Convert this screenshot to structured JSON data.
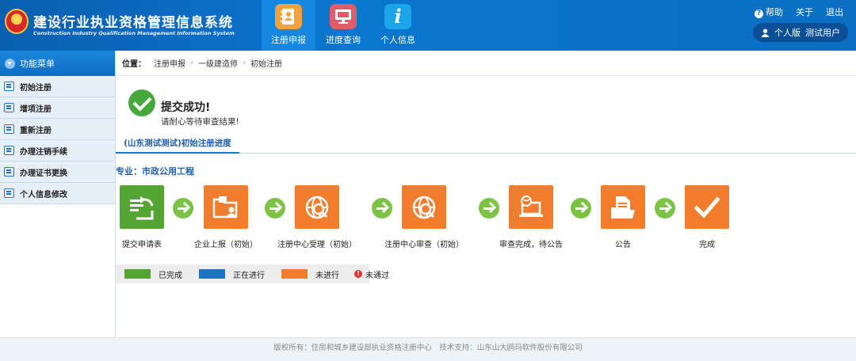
{
  "header": {
    "title": "建设行业执业资格管理信息系统",
    "subtitle": "Construction Industry Qualification Management Information System",
    "nav": [
      {
        "label": "注册申报",
        "icon": "contacts-book-icon",
        "color": "#f3a13a",
        "active": true
      },
      {
        "label": "进度查询",
        "icon": "monitor-icon",
        "color": "#e35a6a",
        "active": false
      },
      {
        "label": "个人信息",
        "icon": "info-icon",
        "color": "#1aa4ea",
        "active": false
      }
    ],
    "links": {
      "help": "帮助",
      "about": "关于",
      "logout": "退出"
    },
    "user": {
      "edition": "个人版",
      "name": "测试用户"
    }
  },
  "sidebar": {
    "title": "功能菜单",
    "items": [
      {
        "label": "初始注册"
      },
      {
        "label": "增项注册"
      },
      {
        "label": "重新注册"
      },
      {
        "label": "办理注销手续"
      },
      {
        "label": "办理证书更换"
      },
      {
        "label": "个人信息修改"
      }
    ]
  },
  "breadcrumb": {
    "label": "位置：",
    "items": [
      "注册申报",
      "一级建造师",
      "初始注册"
    ]
  },
  "result": {
    "title": "提交成功!",
    "message": "请耐心等待审查结果!"
  },
  "tab": {
    "label": "(山东测试测试)初始注册进度"
  },
  "major": {
    "label": "专业：市政公用工程"
  },
  "steps": [
    {
      "label": "提交申请表",
      "status": "completed",
      "icon": "submit-form-icon"
    },
    {
      "label": "企业上报（初始）",
      "status": "pending",
      "icon": "folder-user-icon"
    },
    {
      "label": "注册中心受理（初始）",
      "status": "pending",
      "icon": "globe-search-icon"
    },
    {
      "label": "注册中心审查（初始）",
      "status": "pending",
      "icon": "globe-search-icon"
    },
    {
      "label": "审查完成，待公告",
      "status": "pending",
      "icon": "laptop-globe-icon"
    },
    {
      "label": "公告",
      "status": "pending",
      "icon": "document-folder-icon"
    },
    {
      "label": "完成",
      "status": "pending",
      "icon": "check-icon"
    }
  ],
  "legend": {
    "completed": {
      "label": "已完成",
      "color": "#55a532"
    },
    "in_progress": {
      "label": "正在进行",
      "color": "#1e74c4"
    },
    "pending": {
      "label": "未进行",
      "color": "#f07c2c"
    },
    "failed": {
      "label": "未通过",
      "color": "#e0342c"
    }
  },
  "footer": {
    "text": "版权所有：住房和城乡建设部执业资格注册中心　技术支持：山东山大鸥玛软件股份有限公司"
  }
}
